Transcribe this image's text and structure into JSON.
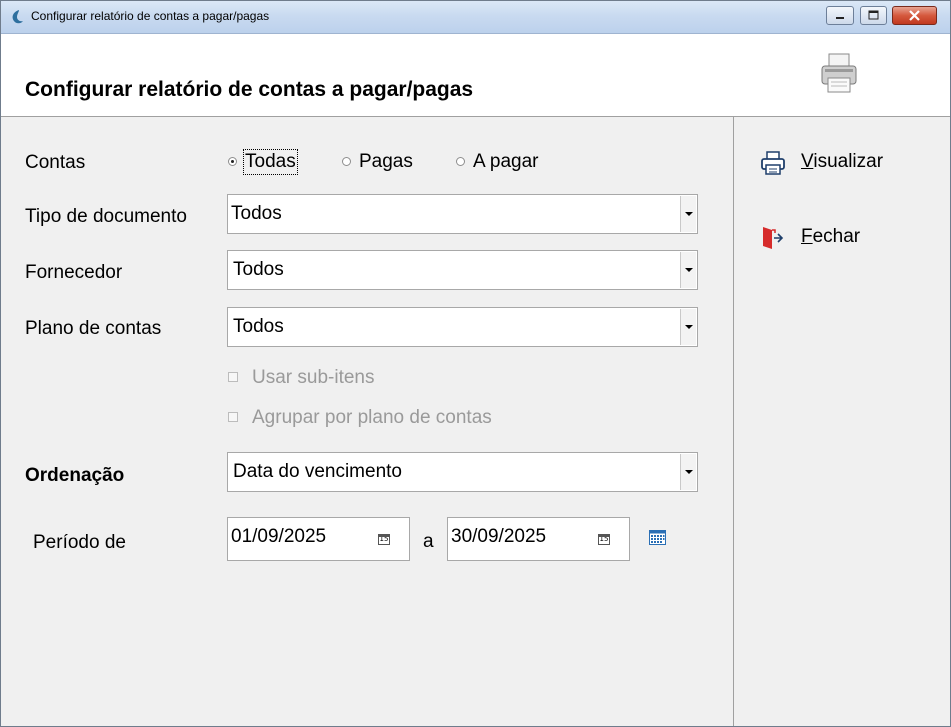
{
  "window": {
    "title": "Configurar relatório de contas a pagar/pagas",
    "controls": [
      "minimize",
      "maximize",
      "close"
    ]
  },
  "header": {
    "title": "Configurar relatório de contas a pagar/pagas",
    "print_icon": "printer-icon"
  },
  "form": {
    "contas": {
      "label": "Contas",
      "options": [
        "Todas",
        "Pagas",
        "A pagar"
      ],
      "selected": "Todas"
    },
    "tipo_documento": {
      "label": "Tipo de documento",
      "value": "Todos"
    },
    "fornecedor": {
      "label": "Fornecedor",
      "value": "Todos"
    },
    "plano_contas": {
      "label": "Plano de contas",
      "value": "Todos"
    },
    "usar_subitens": {
      "label": "Usar sub-itens",
      "checked": false,
      "enabled": false
    },
    "agrupar": {
      "label": "Agrupar por plano de contas",
      "checked": false,
      "enabled": false
    },
    "ordenacao": {
      "label": "Ordenação",
      "value": "Data do vencimento"
    },
    "periodo": {
      "label": "Período de",
      "start": "01/09/2025",
      "separator": "a",
      "end": "30/09/2025",
      "calendar_day": "15"
    }
  },
  "actions": {
    "visualizar": {
      "label_underlined": "V",
      "label_rest": "isualizar",
      "icon": "printer-icon"
    },
    "fechar": {
      "label_underlined": "F",
      "label_rest": "echar",
      "icon": "exit-door-icon"
    }
  },
  "colors": {
    "title_gradient_top": "#dbe8f7",
    "close_button": "#c1391f",
    "accent_blue": "#2a6fb5"
  }
}
